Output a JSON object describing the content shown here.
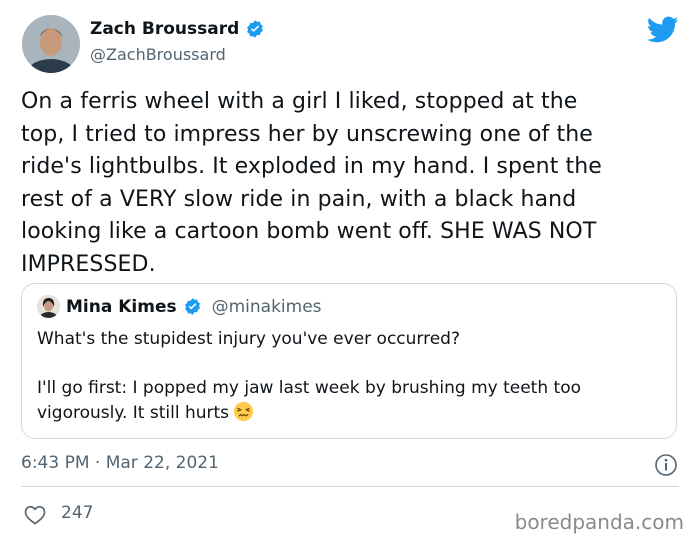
{
  "author": {
    "display_name": "Zach Broussard",
    "handle": "@ZachBroussard",
    "verified_icon": "verified-badge-icon"
  },
  "tweet": {
    "lines": [
      "On a ferris wheel with a girl I liked, stopped at the",
      "top, I tried to impress her by unscrewing one of the",
      "ride's lightbulbs. It exploded in my hand. I spent the",
      "rest of a VERY slow ride in pain, with a black hand",
      "looking like a cartoon bomb went off. SHE WAS NOT",
      "IMPRESSED."
    ],
    "timestamp": "6:43 PM · Mar 22, 2021",
    "like_count": "247"
  },
  "quoted_tweet": {
    "display_name": "Mina Kimes",
    "handle": "@minakimes",
    "line1": "What's the stupidest injury you've ever occurred?",
    "line2": "I'll go first: I popped my jaw last week by brushing my teeth too",
    "line3": "vigorously. It still hurts",
    "emoji": "confounded-face-emoji"
  },
  "watermark": "boredpanda.com",
  "colors": {
    "twitter_blue": "#1d9bf0",
    "text": "#0f1419",
    "secondary_text": "#536471",
    "border": "#cfd9de"
  }
}
